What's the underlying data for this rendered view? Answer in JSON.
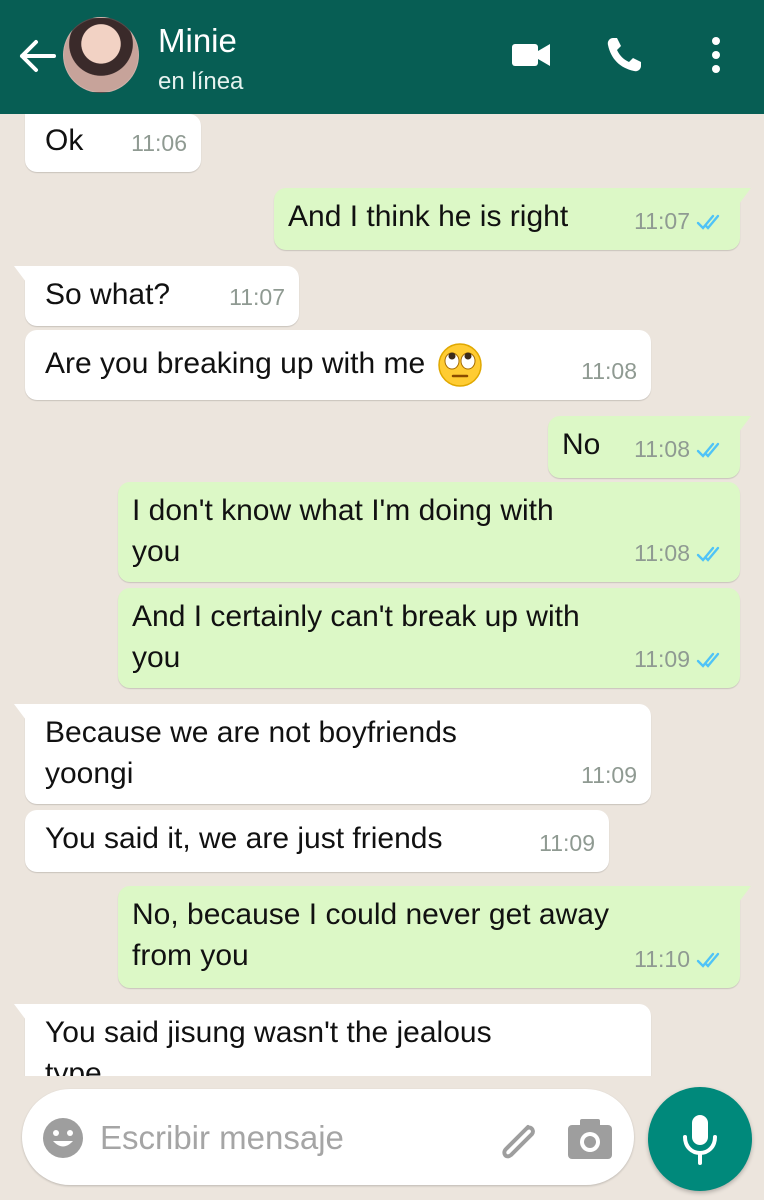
{
  "header": {
    "contact_name": "Minie",
    "status": "en línea"
  },
  "messages": [
    {
      "dir": "in",
      "text": "Ok",
      "time": "11:06"
    },
    {
      "dir": "out",
      "text": "And I think he is right",
      "time": "11:07",
      "read": true
    },
    {
      "dir": "in",
      "text": "So what?",
      "time": "11:07"
    },
    {
      "dir": "in",
      "text": "Are you breaking up with me",
      "emoji": "face-with-rolling-eyes",
      "time": "11:08"
    },
    {
      "dir": "out",
      "text": "No",
      "time": "11:08",
      "read": true
    },
    {
      "dir": "out",
      "line1": "I don't know what I'm doing with",
      "line2": "you",
      "time": "11:08",
      "read": true
    },
    {
      "dir": "out",
      "line1": "And I certainly can't break up with",
      "line2": "you",
      "time": "11:09",
      "read": true
    },
    {
      "dir": "in",
      "line1": "Because we are not boyfriends",
      "line2": "yoongi",
      "time": "11:09"
    },
    {
      "dir": "in",
      "text": "You said it, we are just friends",
      "time": "11:09"
    },
    {
      "dir": "out",
      "line1": "No, because I could never get away",
      "line2": "from you",
      "time": "11:10",
      "read": true
    },
    {
      "dir": "in",
      "line1": "You said jisung wasn't the jealous",
      "line2": "type"
    }
  ],
  "composer": {
    "placeholder": "Escribir mensaje"
  },
  "icons": [
    "back-arrow-icon",
    "video-call-icon",
    "phone-icon",
    "more-options-icon",
    "emoji-icon",
    "attach-icon",
    "camera-icon",
    "mic-icon",
    "double-check-icon"
  ],
  "colors": {
    "header": "#075e54",
    "outgoing_bubble": "#dcf8c6",
    "incoming_bubble": "#ffffff",
    "chat_background": "#ece5dd",
    "read_ticks": "#4fc3f7",
    "mic_button": "#00897b"
  }
}
